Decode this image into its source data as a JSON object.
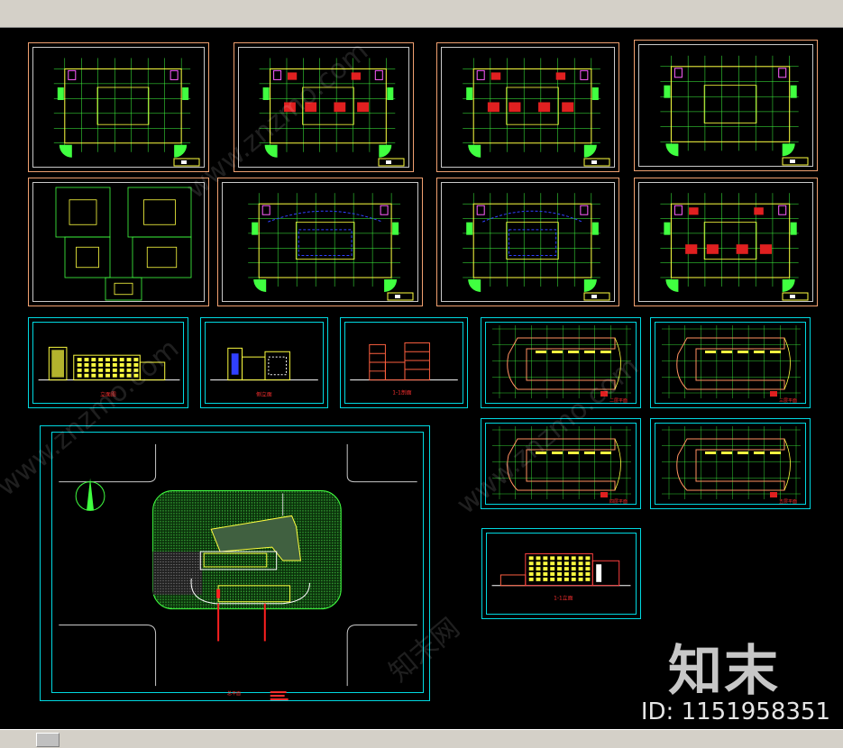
{
  "watermark": {
    "brand": "知末",
    "id_text": "ID: 1151958351",
    "faint_url": "www.znzmo.com",
    "faint_brand": "知末网"
  },
  "drawing_labels": {
    "elev_1": "立面图",
    "elev_2": "侧立面",
    "section": "1-1剖面",
    "plan_a": "二层平面",
    "plan_b": "三层平面",
    "plan_c": "四层平面",
    "plan_d": "五层平面",
    "site": "总平面",
    "elev_big": "1-1立面"
  },
  "colors": {
    "sheet_orange": "#f0a070",
    "sheet_cyan": "#00d8e0",
    "plan_line": "#40ff40",
    "wall_yellow": "#ffff40",
    "room_red": "#e02020",
    "accent_magenta": "#ff60ff",
    "blue": "#3040ff"
  }
}
